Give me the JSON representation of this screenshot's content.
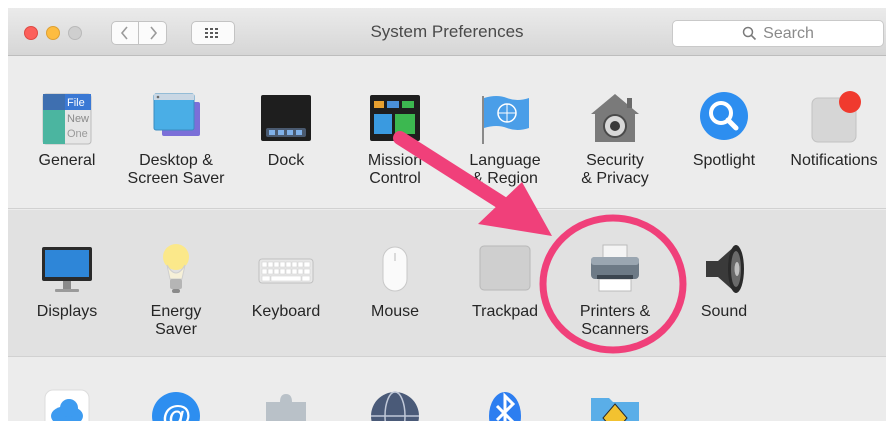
{
  "window": {
    "title": "System Preferences"
  },
  "toolbar": {
    "back_icon": "chevron-left-icon",
    "forward_icon": "chevron-right-icon",
    "show_all_icon": "grid-icon",
    "search_placeholder": "Search"
  },
  "rows": [
    {
      "items": [
        {
          "id": "general",
          "label": "General",
          "icon": "general-icon"
        },
        {
          "id": "desktop",
          "label": "Desktop &\nScreen Saver",
          "icon": "desktop-icon"
        },
        {
          "id": "dock",
          "label": "Dock",
          "icon": "dock-icon"
        },
        {
          "id": "mission",
          "label": "Mission\nControl",
          "icon": "mission-control-icon"
        },
        {
          "id": "language",
          "label": "Language\n& Region",
          "icon": "language-icon"
        },
        {
          "id": "security",
          "label": "Security\n& Privacy",
          "icon": "security-icon"
        },
        {
          "id": "spotlight",
          "label": "Spotlight",
          "icon": "spotlight-icon"
        },
        {
          "id": "notifications",
          "label": "Notifications",
          "icon": "notifications-icon"
        }
      ]
    },
    {
      "items": [
        {
          "id": "displays",
          "label": "Displays",
          "icon": "displays-icon"
        },
        {
          "id": "energy",
          "label": "Energy\nSaver",
          "icon": "energy-saver-icon"
        },
        {
          "id": "keyboard",
          "label": "Keyboard",
          "icon": "keyboard-icon"
        },
        {
          "id": "mouse",
          "label": "Mouse",
          "icon": "mouse-icon"
        },
        {
          "id": "trackpad",
          "label": "Trackpad",
          "icon": "trackpad-icon"
        },
        {
          "id": "printers",
          "label": "Printers &\nScanners",
          "icon": "printer-icon"
        },
        {
          "id": "sound",
          "label": "Sound",
          "icon": "sound-icon"
        }
      ]
    },
    {
      "items": [
        {
          "id": "icloud",
          "icon": "icloud-icon"
        },
        {
          "id": "internet-accounts",
          "icon": "at-sign-icon"
        },
        {
          "id": "extensions",
          "icon": "puzzle-icon"
        },
        {
          "id": "network",
          "icon": "globe-icon"
        },
        {
          "id": "bluetooth",
          "icon": "bluetooth-icon"
        },
        {
          "id": "sharing",
          "icon": "sharing-folder-icon"
        }
      ]
    }
  ],
  "general_icon_text": [
    "File",
    "New",
    "One"
  ],
  "annotation": {
    "arrow_color": "#f0407a",
    "circle_color": "#f0407a",
    "target": "printers"
  }
}
